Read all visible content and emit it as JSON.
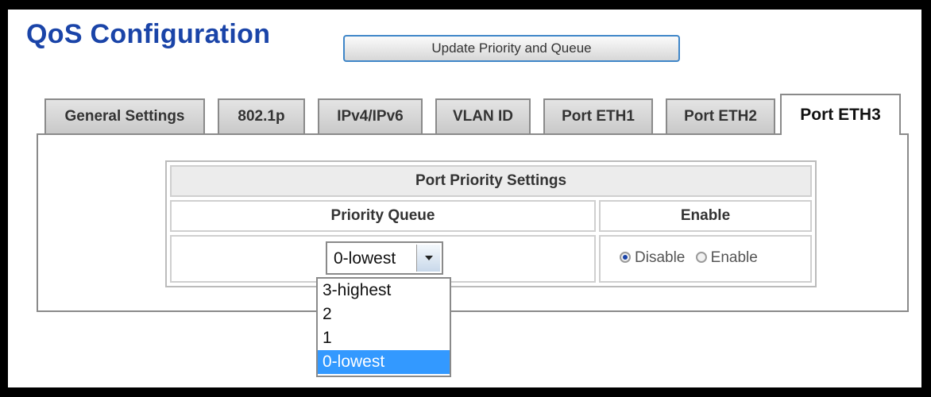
{
  "page": {
    "title": "QoS Configuration",
    "update_button": "Update Priority and Queue"
  },
  "tabs": [
    {
      "label": "General Settings"
    },
    {
      "label": "802.1p"
    },
    {
      "label": "IPv4/IPv6"
    },
    {
      "label": "VLAN ID"
    },
    {
      "label": "Port ETH1"
    },
    {
      "label": "Port ETH2"
    },
    {
      "label": "Port ETH3",
      "active": true
    }
  ],
  "table": {
    "title": "Port Priority Settings",
    "col_priority": "Priority Queue",
    "col_enable": "Enable",
    "priority_value": "0-lowest",
    "radio_disable": "Disable",
    "radio_enable": "Enable",
    "selected_radio": "Disable"
  },
  "dropdown": {
    "options": [
      "3-highest",
      "2",
      "1",
      "0-lowest"
    ],
    "highlighted": "0-lowest"
  },
  "colors": {
    "title": "#1a44a8",
    "highlight": "#3399ff"
  }
}
